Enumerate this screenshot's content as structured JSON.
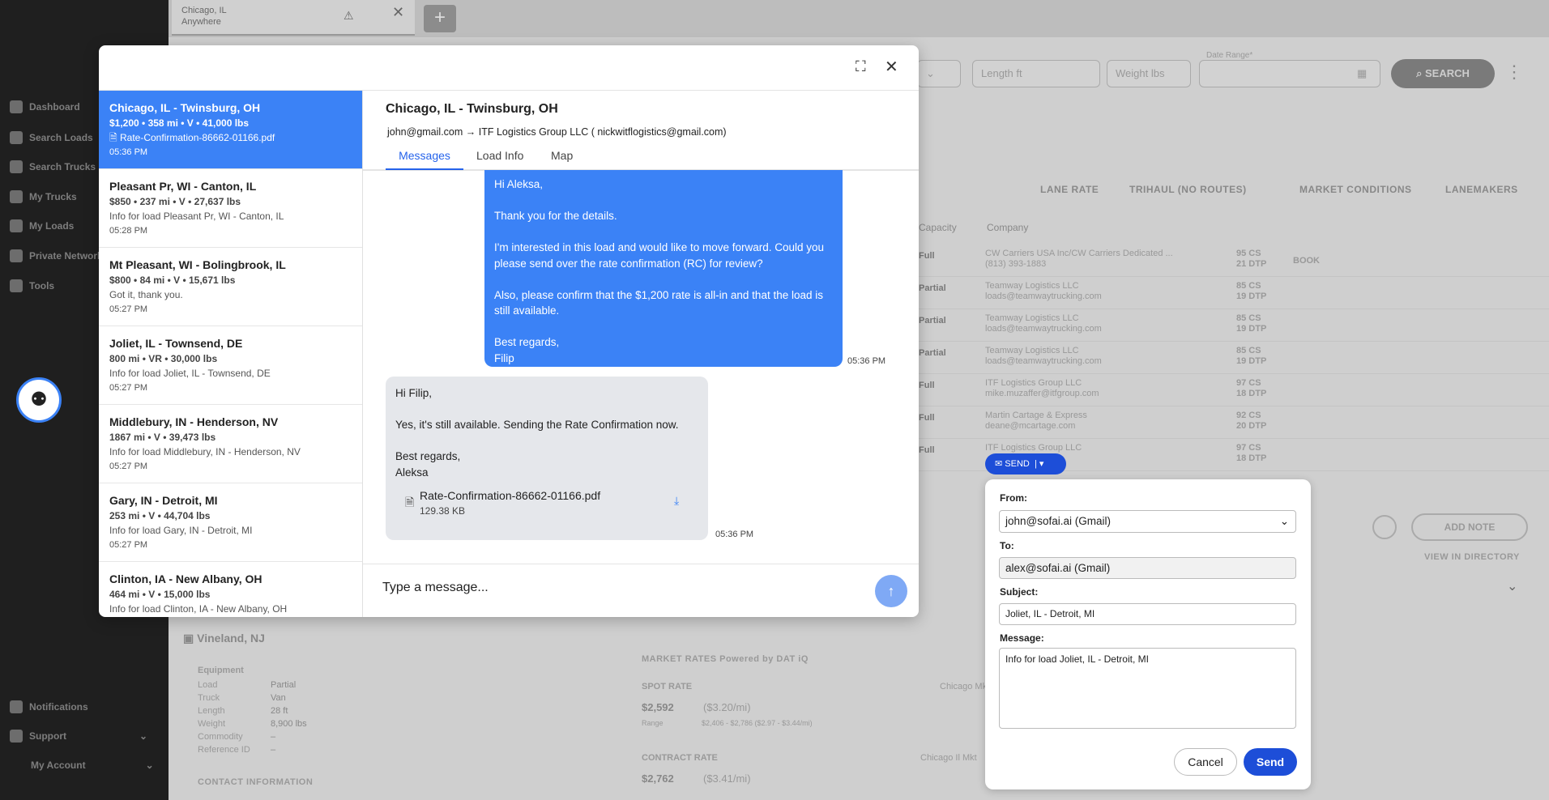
{
  "app": {
    "sidebar": {
      "items": [
        {
          "label": "Dashboard"
        },
        {
          "label": "Search Loads"
        },
        {
          "label": "Search Trucks"
        },
        {
          "label": "My Trucks"
        },
        {
          "label": "My Loads"
        },
        {
          "label": "Private Network"
        },
        {
          "label": "Tools"
        }
      ],
      "notifications_label": "Notifications",
      "support_label": "Support",
      "account_label": "My Account"
    },
    "tab": {
      "line1": "Chicago, IL",
      "line2": "Anywhere"
    },
    "search": {
      "length_placeholder": "Length ft",
      "weight_placeholder": "Weight lbs",
      "date_label": "Date Range*",
      "search_label": "SEARCH"
    },
    "views": [
      "LANE RATE",
      "TRIHAUL (NO ROUTES)",
      "MARKET CONDITIONS",
      "LANEMAKERS"
    ],
    "columns": {
      "capacity": "Capacity",
      "company": "Company",
      "book": "BOOK"
    },
    "rows": [
      {
        "capacity": "Full",
        "company": "CW Carriers USA Inc/CW Carriers Dedicated ...",
        "contact": "(813) 393-1883",
        "cs": "95 CS",
        "dtp": "21 DTP"
      },
      {
        "capacity": "Partial",
        "company": "Teamway Logistics LLC",
        "contact": "loads@teamwaytrucking.com",
        "cs": "85 CS",
        "dtp": "19 DTP"
      },
      {
        "capacity": "Partial",
        "company": "Teamway Logistics LLC",
        "contact": "loads@teamwaytrucking.com",
        "cs": "85 CS",
        "dtp": "19 DTP"
      },
      {
        "capacity": "Partial",
        "company": "Teamway Logistics LLC",
        "contact": "loads@teamwaytrucking.com",
        "cs": "85 CS",
        "dtp": "19 DTP"
      },
      {
        "capacity": "Full",
        "company": "ITF Logistics Group LLC",
        "contact": "mike.muzaffer@itfgroup.com",
        "cs": "97 CS",
        "dtp": "18 DTP"
      },
      {
        "capacity": "Full",
        "company": "Martin Cartage & Express",
        "contact": "deane@mcartage.com",
        "cs": "92 CS",
        "dtp": "20 DTP"
      },
      {
        "capacity": "Full",
        "company": "ITF Logistics Group LLC",
        "contact": "",
        "cs": "97 CS",
        "dtp": "18 DTP"
      }
    ],
    "add_note": "ADD NOTE",
    "view_directory": "VIEW IN DIRECTORY",
    "vineland": "Vineland, NJ",
    "equipment": {
      "heading": "Equipment",
      "labels": [
        "Load",
        "Truck",
        "Length",
        "Weight",
        "Commodity",
        "Reference ID"
      ],
      "values": [
        "Partial",
        "Van",
        "28 ft",
        "8,900 lbs",
        "–",
        "–"
      ]
    },
    "contact_info": "CONTACT INFORMATION",
    "market_rates": "MARKET RATES Powered by DAT iQ",
    "spot_rate": {
      "label": "SPOT RATE",
      "value": "$2,592",
      "per_mile": "($3.20/mi)",
      "range": "$2,406 - $2,786 ($2.97 - $3.44/mi)",
      "range_label": "Range",
      "place": "Chicago Mkt"
    },
    "contract_rate": {
      "label": "CONTRACT RATE",
      "value": "$2,762",
      "per_mile": "($3.41/mi)",
      "place": "Chicago Il Mkt"
    }
  },
  "modal": {
    "conversations": [
      {
        "title": "Chicago, IL - Twinsburg, OH",
        "meta": "$1,200 • 358 mi • V • 41,000 lbs",
        "info": "Rate-Confirmation-86662-01166.pdf",
        "time": "05:36 PM"
      },
      {
        "title": "Pleasant Pr, WI - Canton, IL",
        "meta": "$850 • 237 mi • V • 27,637 lbs",
        "info": "Info for load Pleasant Pr, WI - Canton, IL",
        "time": "05:28 PM"
      },
      {
        "title": "Mt Pleasant, WI - Bolingbrook, IL",
        "meta": "$800 • 84 mi • V • 15,671 lbs",
        "info": "Got it, thank you.",
        "time": "05:27 PM"
      },
      {
        "title": "Joliet, IL - Townsend, DE",
        "meta": "800 mi • VR • 30,000 lbs",
        "info": "Info for load Joliet, IL - Townsend, DE",
        "time": "05:27 PM"
      },
      {
        "title": "Middlebury, IN - Henderson, NV",
        "meta": "1867 mi • V • 39,473 lbs",
        "info": "Info for load Middlebury, IN - Henderson, NV",
        "time": "05:27 PM"
      },
      {
        "title": "Gary, IN - Detroit, MI",
        "meta": "253 mi • V • 44,704 lbs",
        "info": "Info for load Gary, IN - Detroit, MI",
        "time": "05:27 PM"
      },
      {
        "title": "Clinton, IA - New Albany, OH",
        "meta": "464 mi • V • 15,000 lbs",
        "info": "Info for load Clinton, IA - New Albany, OH",
        "time": ""
      }
    ],
    "chat": {
      "title": "Chicago, IL - Twinsburg, OH",
      "from": "john@gmail.com",
      "to": "ITF Logistics Group LLC ( nickwitflogistics@gmail.com)",
      "tabs": [
        "Messages",
        "Load Info",
        "Map"
      ],
      "outgoing": [
        "Hi Aleksa,",
        "",
        "Thank you for the details.",
        "",
        "I'm interested in this load and would like to move forward. Could you please send over the rate confirmation (RC) for review?",
        "",
        "Also, please confirm that the $1,200 rate is all-in and that the load is still available.",
        "",
        "Best regards,",
        "Filip"
      ],
      "outgoing_time": "05:36 PM",
      "incoming": [
        "Hi Filip,",
        "",
        "Yes, it's still available. Sending the Rate Confirmation now.",
        "",
        "Best regards,",
        "Aleksa"
      ],
      "attachment": {
        "name": "Rate-Confirmation-86662-01166.pdf",
        "size": "129.38 KB"
      },
      "incoming_time": "05:36 PM",
      "composer_placeholder": "Type a message..."
    }
  },
  "send_popover": {
    "pill_label": "SEND",
    "from_label": "From:",
    "from_value": "john@sofai.ai (Gmail)",
    "to_label": "To:",
    "to_value": "alex@sofai.ai (Gmail)",
    "subject_label": "Subject:",
    "subject_value": "Joliet, IL - Detroit, MI",
    "message_label": "Message:",
    "message_value": "Info for load Joliet, IL - Detroit, MI",
    "cancel_label": "Cancel",
    "send_label": "Send"
  }
}
